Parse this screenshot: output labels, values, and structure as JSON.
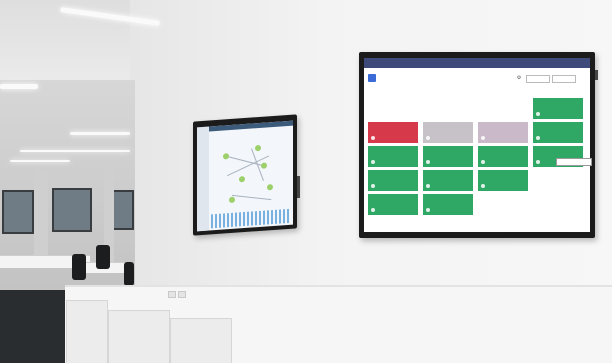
{
  "big_screen": {
    "topbar_text": "",
    "app_name": "",
    "app_sub": "",
    "controls": [
      "",
      ""
    ],
    "tiles": [
      {
        "label": "",
        "sub": "",
        "value": "",
        "color": "#d63a4a"
      },
      {
        "label": "",
        "sub": "",
        "value": "",
        "color": "#c7c2c8"
      },
      {
        "label": "",
        "sub": "",
        "value": "",
        "color": "#c9b9c9"
      },
      {
        "label": "",
        "sub": "",
        "value": "",
        "color": "#2fa866"
      },
      {
        "label": "",
        "sub": "",
        "value": "",
        "color": "#2fa866"
      },
      {
        "label": "",
        "sub": "",
        "value": "",
        "color": "#2fa866"
      },
      {
        "label": "",
        "sub": "",
        "value": "",
        "color": "#2fa866"
      },
      {
        "label": "",
        "sub": "",
        "value": "",
        "color": "#2fa866"
      },
      {
        "label": "",
        "sub": "",
        "value": "",
        "color": "#2fa866"
      },
      {
        "label": "",
        "sub": "",
        "value": "",
        "color": "#2fa866"
      },
      {
        "label": "",
        "sub": "",
        "value": "",
        "color": "#2fa866"
      },
      {
        "label": "",
        "sub": "",
        "value": "",
        "color": "#2fa866"
      },
      {
        "label": "",
        "sub": "",
        "value": "",
        "color": "#2fa866"
      },
      {
        "label": "",
        "sub": "",
        "value": "",
        "color": "#2fa866"
      }
    ],
    "tooltip": ""
  },
  "colors": {
    "topbar": "#3e4a7a",
    "tile_green": "#2fa866",
    "tile_red": "#d63a4a",
    "tile_grey": "#c7c2c8"
  }
}
